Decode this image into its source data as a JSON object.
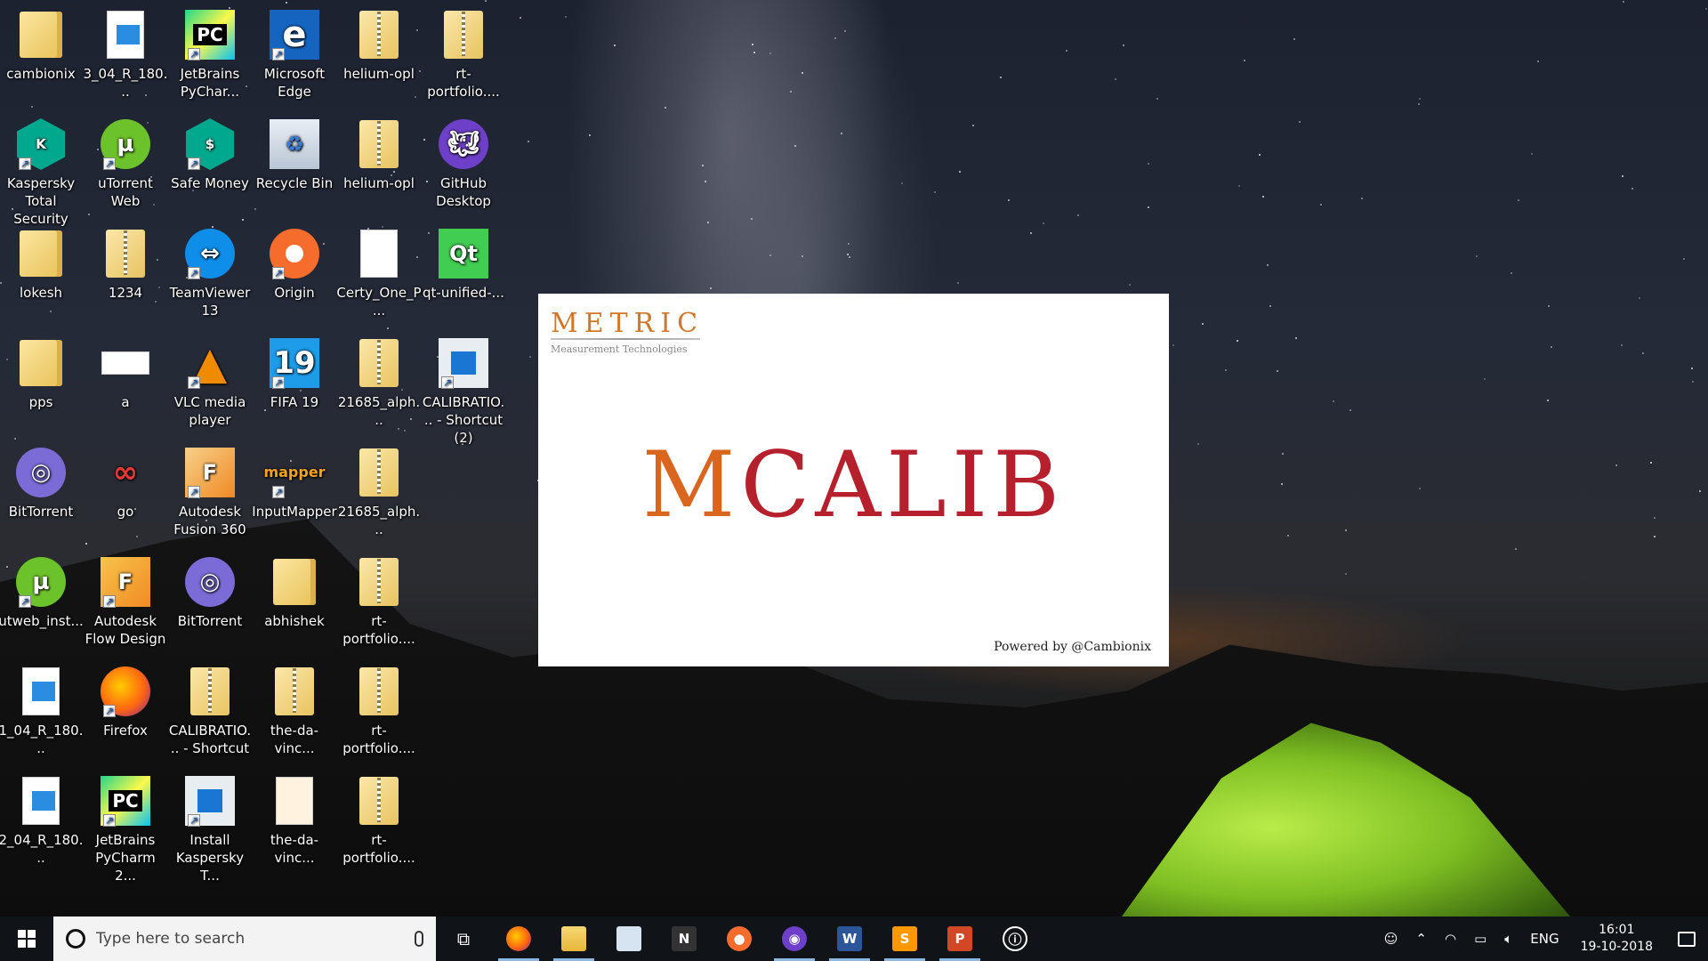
{
  "desktop": {
    "icons": [
      {
        "label": "cambionix",
        "kind": "folder"
      },
      {
        "label": "3_04_R_180...",
        "kind": "video"
      },
      {
        "label": "JetBrains PyChar...",
        "kind": "pycharm"
      },
      {
        "label": "Microsoft Edge",
        "kind": "edge"
      },
      {
        "label": "helium-opl",
        "kind": "zip"
      },
      {
        "label": "rt-portfolio....",
        "kind": "zip"
      },
      {
        "label": "Kaspersky Total Security",
        "kind": "kaspersky"
      },
      {
        "label": "uTorrent Web",
        "kind": "utorrent"
      },
      {
        "label": "Safe Money",
        "kind": "safemoney"
      },
      {
        "label": "Recycle Bin",
        "kind": "recycle"
      },
      {
        "label": "helium-opl",
        "kind": "zip"
      },
      {
        "label": "GitHub Desktop",
        "kind": "github"
      },
      {
        "label": "lokesh",
        "kind": "folder"
      },
      {
        "label": "1234",
        "kind": "zip"
      },
      {
        "label": "TeamViewer 13",
        "kind": "teamviewer"
      },
      {
        "label": "Origin",
        "kind": "origin"
      },
      {
        "label": "Certy_One_P...",
        "kind": "file"
      },
      {
        "label": "qt-unified-...",
        "kind": "qt"
      },
      {
        "label": "pps",
        "kind": "folder"
      },
      {
        "label": "a",
        "kind": "image"
      },
      {
        "label": "VLC media player",
        "kind": "vlc"
      },
      {
        "label": "FIFA 19",
        "kind": "fifa"
      },
      {
        "label": "21685_alph...",
        "kind": "zip"
      },
      {
        "label": "CALIBRATIO... - Shortcut (2)",
        "kind": "calib"
      },
      {
        "label": "BitTorrent",
        "kind": "bittorrent"
      },
      {
        "label": "go",
        "kind": "go"
      },
      {
        "label": "Autodesk Fusion 360",
        "kind": "fusion"
      },
      {
        "label": "InputMapper",
        "kind": "inputmapper"
      },
      {
        "label": "21685_alph...",
        "kind": "zip"
      },
      {
        "label": "utweb_inst...",
        "kind": "utorrent"
      },
      {
        "label": "Autodesk Flow Design",
        "kind": "flow"
      },
      {
        "label": "BitTorrent",
        "kind": "bittorrent"
      },
      {
        "label": "abhishek",
        "kind": "folder"
      },
      {
        "label": "rt-portfolio....",
        "kind": "zip"
      },
      {
        "label": "1_04_R_180...",
        "kind": "video"
      },
      {
        "label": "Firefox",
        "kind": "firefox"
      },
      {
        "label": "CALIBRATIO... - Shortcut",
        "kind": "zip"
      },
      {
        "label": "the-da-vinc...",
        "kind": "zip"
      },
      {
        "label": "rt-portfolio....",
        "kind": "zip"
      },
      {
        "label": "2_04_R_180...",
        "kind": "video"
      },
      {
        "label": "JetBrains PyCharm 2...",
        "kind": "pycharm"
      },
      {
        "label": "Install Kaspersky T...",
        "kind": "calib"
      },
      {
        "label": "the-da-vinc...",
        "kind": "vlcfile"
      },
      {
        "label": "rt-portfolio....",
        "kind": "zip"
      }
    ]
  },
  "splash": {
    "brand": "METRIC",
    "brand_sub": "Measurement Technologies",
    "title_first": "M",
    "title_rest": "CALIB",
    "powered_by": "Powered by @Cambionix"
  },
  "taskbar": {
    "search_placeholder": "Type here to search",
    "apps": [
      {
        "name": "firefox",
        "active": true
      },
      {
        "name": "file-explorer",
        "active": true
      },
      {
        "name": "photos",
        "active": false
      },
      {
        "name": "notion",
        "active": false
      },
      {
        "name": "origin",
        "active": false
      },
      {
        "name": "github-desktop",
        "active": true
      },
      {
        "name": "word",
        "active": true
      },
      {
        "name": "sublime-text",
        "active": true
      },
      {
        "name": "powerpoint",
        "active": true
      },
      {
        "name": "mcalib",
        "active": false
      }
    ],
    "tray": {
      "language": "ENG",
      "time": "16:01",
      "date": "19-10-2018"
    }
  },
  "colors": {
    "taskbar_bg": "#101318",
    "splash_red": "#b5202c",
    "splash_orange": "#d9651e"
  }
}
